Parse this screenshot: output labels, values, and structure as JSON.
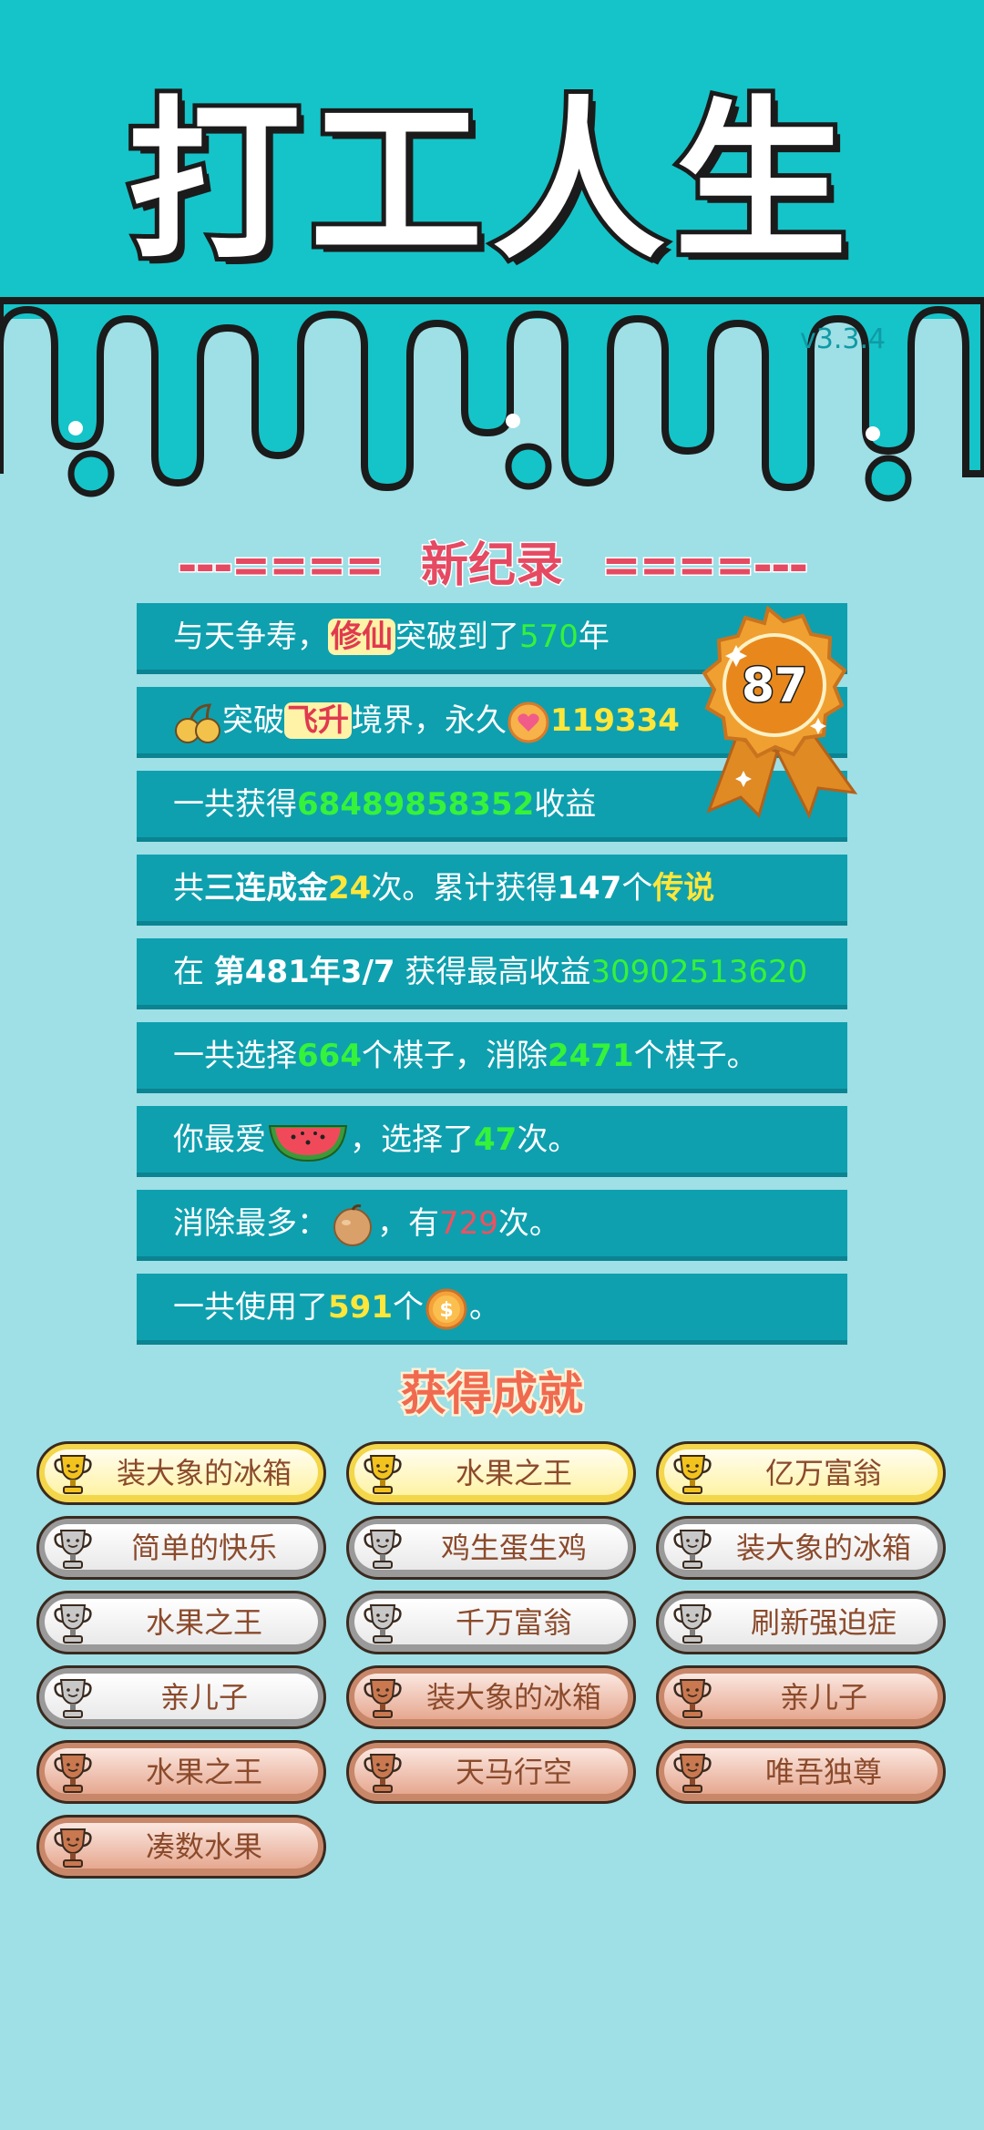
{
  "header": {
    "title": "打工人生",
    "version": "v3.3.4"
  },
  "records": {
    "title": "新纪录",
    "rows": [
      {
        "parts": [
          "与天争寿，",
          "修仙",
          "突破到了",
          "570",
          "年"
        ]
      },
      {
        "parts": [
          "突破",
          "飞升",
          "境界，永久",
          "119334"
        ]
      },
      {
        "parts": [
          "一共获得",
          "68489858352",
          "收益"
        ]
      },
      {
        "parts": [
          "共",
          "三连成金",
          "24",
          "次。累计获得",
          "147",
          "个",
          "传说"
        ]
      },
      {
        "parts": [
          "在 ",
          "第481年3/7",
          " 获得最高收益",
          "30902513620"
        ]
      },
      {
        "parts": [
          "一共选择",
          "664",
          "个棋子，消除",
          "2471",
          "个棋子。"
        ]
      },
      {
        "parts": [
          "你最爱",
          "，选择了",
          "47",
          "次。"
        ]
      },
      {
        "parts": [
          "消除最多：",
          "，有",
          "729",
          "次。"
        ]
      },
      {
        "parts": [
          "一共使用了",
          "591",
          "个",
          "。"
        ]
      }
    ],
    "badge_number": "87"
  },
  "achievements": {
    "title": "获得成就",
    "items": [
      {
        "label": "装大象的冰箱",
        "tier": "gold"
      },
      {
        "label": "水果之王",
        "tier": "gold"
      },
      {
        "label": "亿万富翁",
        "tier": "gold"
      },
      {
        "label": "简单的快乐",
        "tier": "silver"
      },
      {
        "label": "鸡生蛋生鸡",
        "tier": "silver"
      },
      {
        "label": "装大象的冰箱",
        "tier": "silver"
      },
      {
        "label": "水果之王",
        "tier": "silver"
      },
      {
        "label": "千万富翁",
        "tier": "silver"
      },
      {
        "label": "刷新强迫症",
        "tier": "silver"
      },
      {
        "label": "亲儿子",
        "tier": "silver"
      },
      {
        "label": "装大象的冰箱",
        "tier": "bronze"
      },
      {
        "label": "亲儿子",
        "tier": "bronze"
      },
      {
        "label": "水果之王",
        "tier": "bronze"
      },
      {
        "label": "天马行空",
        "tier": "bronze"
      },
      {
        "label": "唯吾独尊",
        "tier": "bronze"
      },
      {
        "label": "凑数水果",
        "tier": "bronze"
      }
    ]
  },
  "colors": {
    "header_bg": "#14c4c8",
    "page_bg": "#9fdfe6",
    "row_bg": "#0ea0af",
    "highlight_green": "#35f23a",
    "highlight_yellow": "#ffe63a",
    "highlight_red": "#f0505f",
    "title_red": "#e54a62"
  },
  "icons": [
    "cherry-icon",
    "heart-coin-icon",
    "watermelon-icon",
    "peach-icon",
    "gold-coin-icon",
    "medal-badge-icon",
    "trophy-icon"
  ]
}
